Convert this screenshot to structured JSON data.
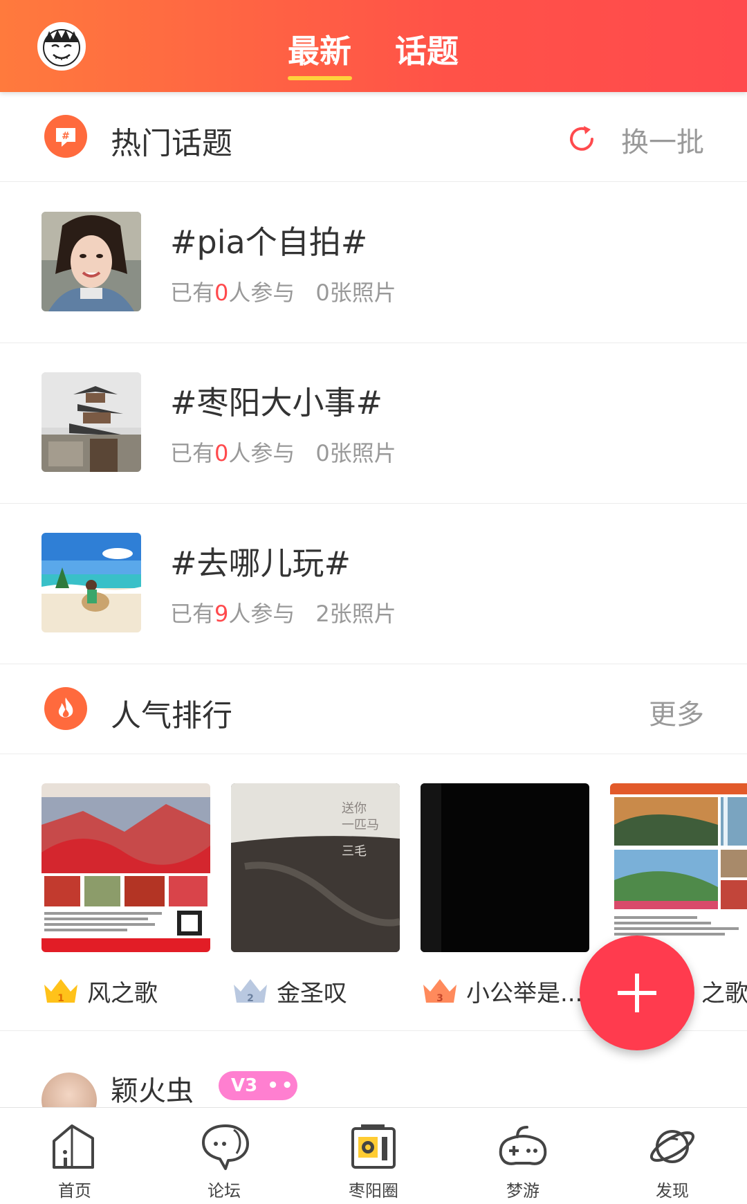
{
  "header": {
    "tabs": [
      {
        "label": "最新",
        "active": true
      },
      {
        "label": "话题",
        "active": false
      }
    ],
    "accent": "#ffd23c"
  },
  "hot_topics": {
    "title": "热门话题",
    "refresh_label": "换一批",
    "items": [
      {
        "title": "#pia个自拍#",
        "prefix": "已有",
        "count": "0",
        "suffix": "人参与",
        "photos": "0张照片"
      },
      {
        "title": "#枣阳大小事#",
        "prefix": "已有",
        "count": "0",
        "suffix": "人参与",
        "photos": "0张照片"
      },
      {
        "title": "#去哪儿玩#",
        "prefix": "已有",
        "count": "9",
        "suffix": "人参与",
        "photos": "2张照片"
      }
    ]
  },
  "ranking": {
    "title": "人气排行",
    "more_label": "更多",
    "items": [
      {
        "name": "风之歌",
        "rank": "1"
      },
      {
        "name": "金圣叹",
        "rank": "2"
      },
      {
        "name": "小公举是...",
        "rank": "3"
      },
      {
        "name": "之歌",
        "rank": ""
      }
    ],
    "book_text": [
      "送你",
      "一匹马",
      "三毛"
    ]
  },
  "post": {
    "username": "颖火虫",
    "badge": "V3"
  },
  "bottom_nav": [
    {
      "label": "首页",
      "icon": "home-icon"
    },
    {
      "label": "论坛",
      "icon": "chat-bubbles-icon"
    },
    {
      "label": "枣阳圈",
      "icon": "camera-circle-icon"
    },
    {
      "label": "梦游",
      "icon": "gamepad-icon"
    },
    {
      "label": "发现",
      "icon": "planet-icon"
    }
  ],
  "colors": {
    "header_from": "#ff7a3d",
    "header_to": "#ff4a4d",
    "highlight": "#ff4a4d",
    "fab": "#ff3b4e"
  }
}
